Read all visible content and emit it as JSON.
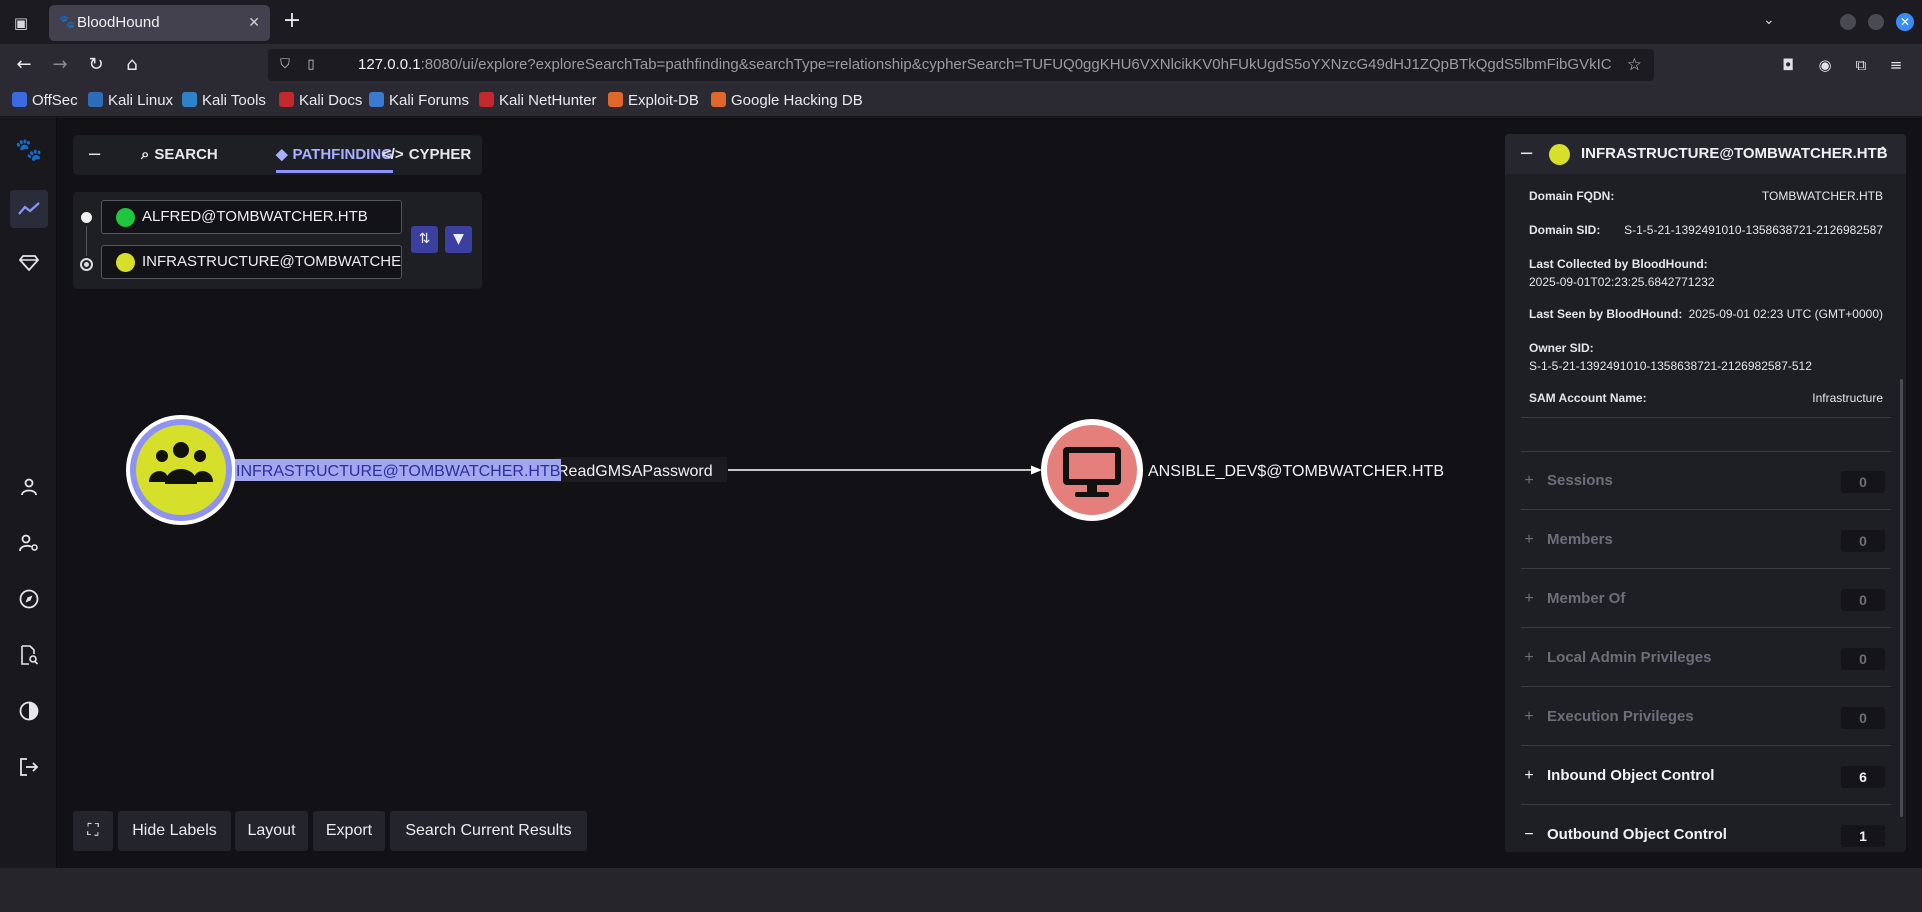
{
  "browser": {
    "tab_title": "BloodHound",
    "url_host": "127.0.0.1",
    "url_rest": ":8080/ui/explore?exploreSearchTab=pathfinding&searchType=relationship&cypherSearch=TUFUQ0ggKHU6VXNlcikKV0hFUkUgdS5oYXNzcG49dHJ1ZQpBTkQgdS5lbmFibGVkIC",
    "bookmarks": [
      {
        "label": "OffSec",
        "color": "#3b6ae0"
      },
      {
        "label": "Kali Linux",
        "color": "#2d6db8"
      },
      {
        "label": "Kali Tools",
        "color": "#2e82c9"
      },
      {
        "label": "Kali Docs",
        "color": "#c4282d"
      },
      {
        "label": "Kali Forums",
        "color": "#3a7ad1"
      },
      {
        "label": "Kali NetHunter",
        "color": "#c4282d"
      },
      {
        "label": "Exploit-DB",
        "color": "#e0662a"
      },
      {
        "label": "Google Hacking DB",
        "color": "#e0662a"
      }
    ]
  },
  "explore": {
    "tabs": [
      "SEARCH",
      "PATHFINDING",
      "CYPHER"
    ],
    "active_tab": "PATHFINDING",
    "start_node": "ALFRED@TOMBWATCHER.HTB",
    "end_node": "INFRASTRUCTURE@TOMBWATCHER.H"
  },
  "graph": {
    "source": {
      "label": "INFRASTRUCTURE@TOMBWATCHER.HTB",
      "kind": "group",
      "color": "#d6e02b"
    },
    "target": {
      "label": "ANSIBLE_DEV$@TOMBWATCHER.HTB",
      "kind": "computer",
      "color": "#e57f7b"
    },
    "edge_label": "ReadGMSAPassword"
  },
  "toolbar": {
    "hide_labels": "Hide Labels",
    "layout": "Layout",
    "export": "Export",
    "search_current": "Search Current Results"
  },
  "entity_panel": {
    "title": "INFRASTRUCTURE@TOMBWATCHER.HTB",
    "properties": [
      {
        "key": "Domain FQDN:",
        "value": "TOMBWATCHER.HTB"
      },
      {
        "key": "Domain SID:",
        "value": "S-1-5-21-1392491010-1358638721-2126982587"
      },
      {
        "key": "Last Collected by BloodHound:",
        "value": "2025-09-01T02:23:25.6842771232"
      },
      {
        "key": "Last Seen by BloodHound:",
        "value": "2025-09-01 02:23 UTC (GMT+0000)"
      },
      {
        "key": "Owner SID:",
        "value": "S-1-5-21-1392491010-1358638721-2126982587-512"
      },
      {
        "key": "SAM Account Name:",
        "value": "Infrastructure"
      }
    ],
    "sections": [
      {
        "label": "Sessions",
        "count": "0",
        "sign": "+",
        "state": "dim"
      },
      {
        "label": "Members",
        "count": "0",
        "sign": "+",
        "state": "dim"
      },
      {
        "label": "Member Of",
        "count": "0",
        "sign": "+",
        "state": "dim"
      },
      {
        "label": "Local Admin Privileges",
        "count": "0",
        "sign": "+",
        "state": "dim"
      },
      {
        "label": "Execution Privileges",
        "count": "0",
        "sign": "+",
        "state": "dim"
      },
      {
        "label": "Inbound Object Control",
        "count": "6",
        "sign": "+",
        "state": "on"
      },
      {
        "label": "Outbound Object Control",
        "count": "1",
        "sign": "−",
        "state": "on"
      }
    ]
  }
}
